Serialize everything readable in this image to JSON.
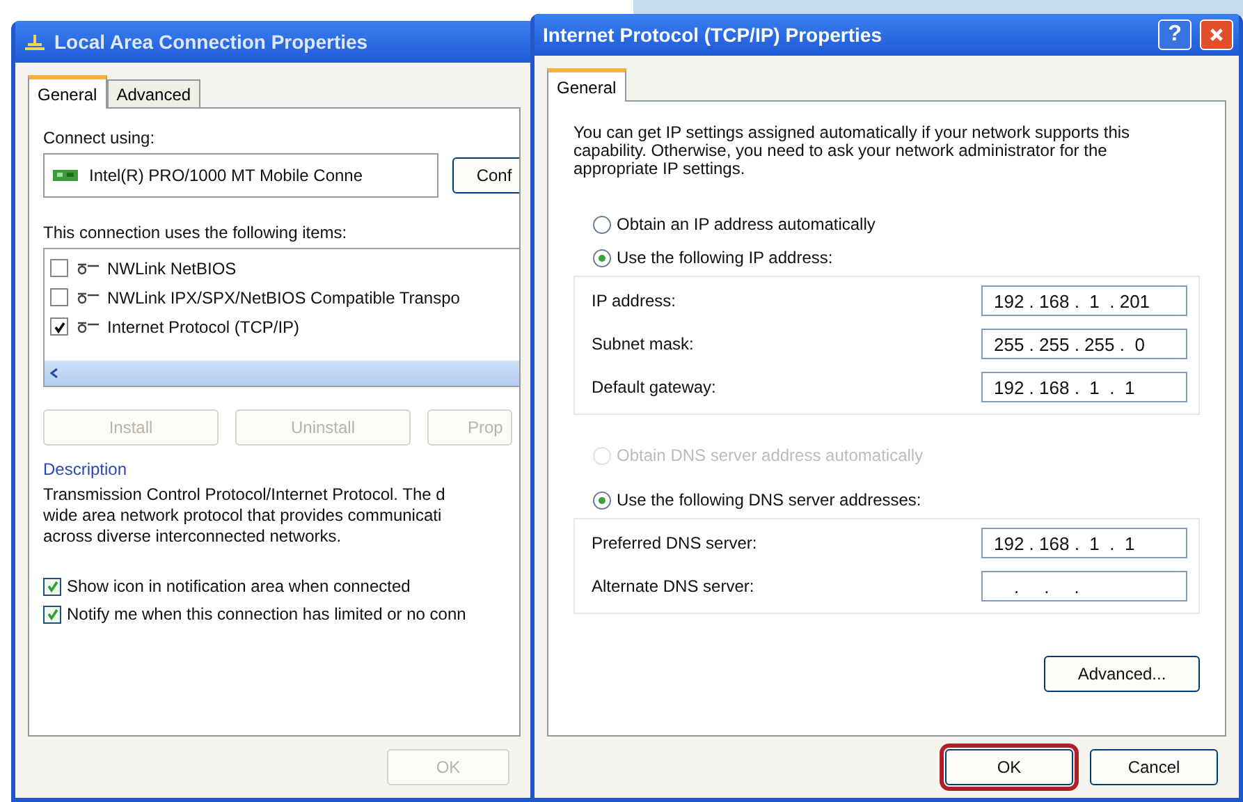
{
  "background_window": {
    "title": "Local Area Connection Properties",
    "tabs": [
      {
        "label": "General",
        "selected": true
      },
      {
        "label": "Advanced",
        "selected": false
      }
    ],
    "connect_using_label": "Connect using:",
    "adapter_name": "Intel(R) PRO/1000 MT Mobile Conne",
    "configure_button": "Conf",
    "items_label": "This connection uses the following items:",
    "items": [
      {
        "label": "NWLink NetBIOS",
        "checked": false
      },
      {
        "label": "NWLink IPX/SPX/NetBIOS Compatible Transpo",
        "checked": false
      },
      {
        "label": "Internet Protocol (TCP/IP)",
        "checked": true
      }
    ],
    "buttons": [
      {
        "label": "Install",
        "disabled": true
      },
      {
        "label": "Uninstall",
        "disabled": true
      },
      {
        "label": "Prop",
        "disabled": true
      }
    ],
    "description_label": "Description",
    "description_lines": [
      "Transmission Control Protocol/Internet Protocol. The d",
      "wide area network protocol that provides communicati",
      "across diverse interconnected networks."
    ],
    "options": [
      {
        "label": "Show icon in notification area when connected",
        "checked": true
      },
      {
        "label": "Notify me when this connection has limited or no conn",
        "checked": true
      }
    ],
    "ok_button": {
      "label": "OK",
      "disabled": true
    }
  },
  "dialog": {
    "title": "Internet Protocol (TCP/IP) Properties",
    "help_button": "?",
    "tabs": [
      {
        "label": "General",
        "selected": true
      }
    ],
    "intro": "You can get IP settings assigned automatically if your network supports this capability. Otherwise, you need to ask your network administrator for the appropriate IP settings.",
    "ip_mode": [
      {
        "label": "Obtain an IP address automatically",
        "selected": false,
        "disabled": false
      },
      {
        "label": "Use the following IP address:",
        "selected": true,
        "disabled": false
      }
    ],
    "ip_fields": [
      {
        "label": "IP address:",
        "value": "192 . 168 .  1  . 201"
      },
      {
        "label": "Subnet mask:",
        "value": "255 . 255 . 255 .  0"
      },
      {
        "label": "Default gateway:",
        "value": "192 . 168 .  1  .  1"
      }
    ],
    "dns_mode": [
      {
        "label": "Obtain DNS server address automatically",
        "selected": false,
        "disabled": true
      },
      {
        "label": "Use the following DNS server addresses:",
        "selected": true,
        "disabled": false
      }
    ],
    "dns_fields": [
      {
        "label": "Preferred DNS server:",
        "value": "192 . 168 .  1  .  1"
      },
      {
        "label": "Alternate DNS server:",
        "value": "    .     .     ."
      }
    ],
    "advanced_button": "Advanced...",
    "ok_button": {
      "label": "OK",
      "highlighted": true
    },
    "cancel_button": "Cancel"
  }
}
